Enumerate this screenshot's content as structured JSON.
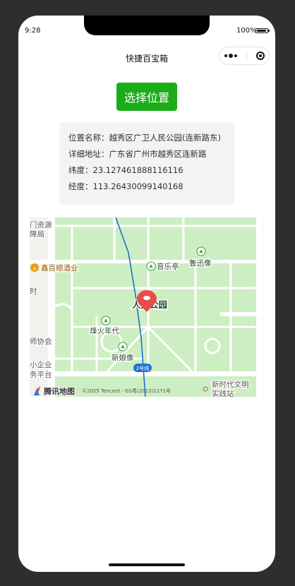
{
  "status": {
    "time": "9:28",
    "battery": "100%"
  },
  "nav": {
    "title": "快捷百宝箱"
  },
  "button": {
    "label": "选择位置"
  },
  "location": {
    "name_label": "位置名称：",
    "name": "越秀区广卫人民公园(连新路东)",
    "address_label": "详细地址：",
    "address": "广东省广州市越秀区连新路",
    "lat_label": "纬度：",
    "lat": "23.127461888116116",
    "lng_label": "经度：",
    "lng": "113.26430099140168"
  },
  "map": {
    "park_label": "人民公园",
    "pois": {
      "yinyueting": "音乐亭",
      "luxunxiang": "鲁迅像",
      "fenghuo": "烽火年代",
      "xinniang": "新娘像",
      "xinbaishun": "鑫百顺酒业",
      "ziyuan_1": "门资源",
      "ziyuan_2": "障局",
      "xiehui": "师协会",
      "xiaoqiye_1": "小企业",
      "xiaoqiye_2": "务平台",
      "wenming_1": "新时代文明",
      "wenming_2": "实践站",
      "left_char": "时"
    },
    "metro_badge": "2号线",
    "brand": "腾讯地图",
    "copyright": "©2025 Tencent - GS粤(2023)1171号",
    "colors": {
      "park": "#cdeec2",
      "road": "#ffffff",
      "metro": "#1f6fd6",
      "pin": "#e84c4c",
      "land": "#f1f1ee"
    }
  }
}
